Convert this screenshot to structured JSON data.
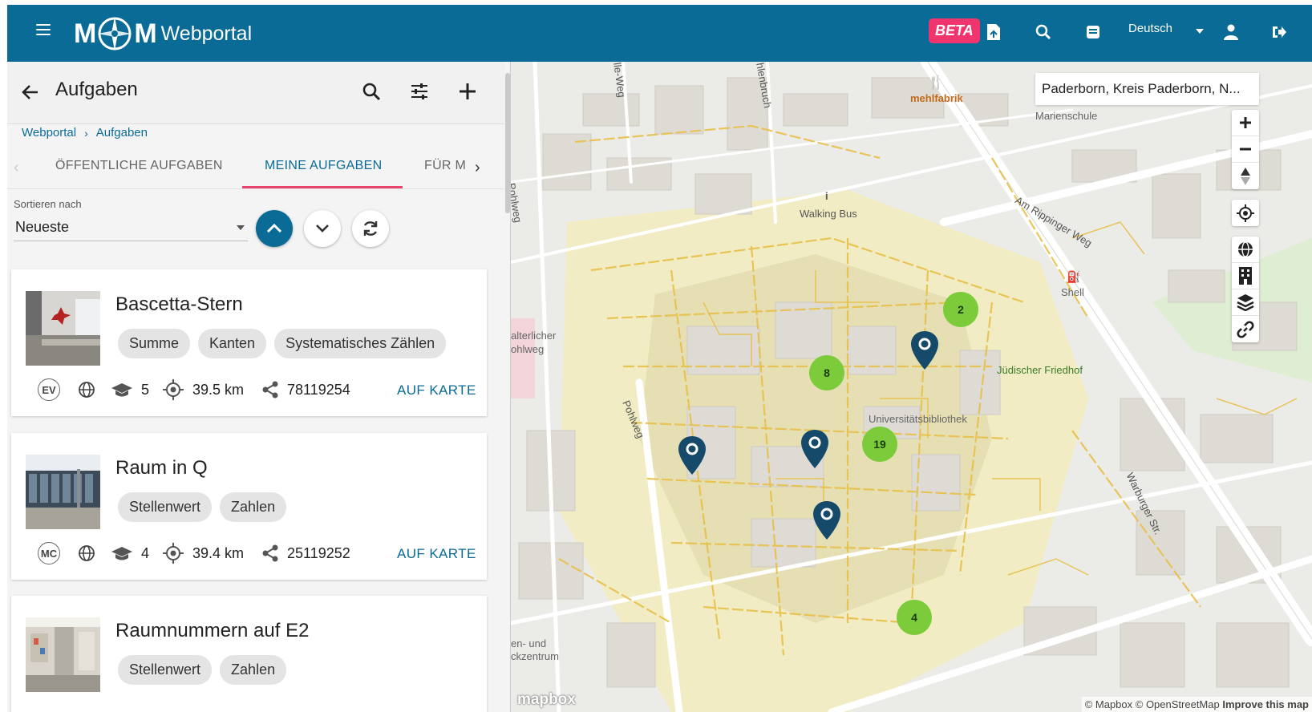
{
  "header": {
    "logo_m1": "M",
    "logo_m2": "M",
    "logo_title": "Webportal",
    "beta_label": "BETA",
    "language": "Deutsch"
  },
  "panel": {
    "title": "Aufgaben",
    "breadcrumb": [
      "Webportal",
      "Aufgaben"
    ],
    "tabs": [
      "ÖFFENTLICHE AUFGABEN",
      "MEINE AUFGABEN",
      "FÜR M"
    ],
    "sort_label": "Sortieren nach",
    "sort_value": "Neueste"
  },
  "tasks": [
    {
      "title": "Bascetta-Stern",
      "chips": [
        "Summe",
        "Kanten",
        "Systematisches Zählen"
      ],
      "badge": "EV",
      "grade": "5",
      "distance": "39.5 km",
      "code": "78119254",
      "action": "AUF KARTE"
    },
    {
      "title": "Raum in Q",
      "chips": [
        "Stellenwert",
        "Zahlen"
      ],
      "badge": "MC",
      "grade": "4",
      "distance": "39.4 km",
      "code": "25119252",
      "action": "AUF KARTE"
    },
    {
      "title": "Raumnummern auf E2",
      "chips": [
        "Stellenwert",
        "Zahlen"
      ]
    }
  ],
  "map": {
    "search_value": "Paderborn, Kreis Paderborn, N...",
    "labels": {
      "mehlfabrik": "mehlfabrik",
      "marienschule": "Marienschule",
      "walking_bus": "Walking Bus",
      "am_rippinger": "Am Rippinger Weg",
      "shell": "Shell",
      "juedischer": "Jüdischer Friedhof",
      "unibib": "Universitätsbibliothek",
      "pohlweg1": "Pohlweg",
      "pohlweg2": "Pohlweg",
      "warburger": "Warburger Str.",
      "alterlicher1": "alterlicher",
      "alterlicher2": "ohlweg",
      "ile_weg": "lle-Weg",
      "henbruch": "hlenbruch",
      "enund": "en- und",
      "kzentrum": "ckzentrum"
    },
    "clusters": [
      "2",
      "8",
      "19",
      "4"
    ],
    "mapbox": "mapbox",
    "attribution": "© Mapbox © OpenStreetMap",
    "improve": "Improve this map"
  },
  "colors": {
    "primary": "#0a6b96",
    "accent": "#e8446e",
    "beta": "#f0356e",
    "cluster": "#7ccb3a"
  }
}
